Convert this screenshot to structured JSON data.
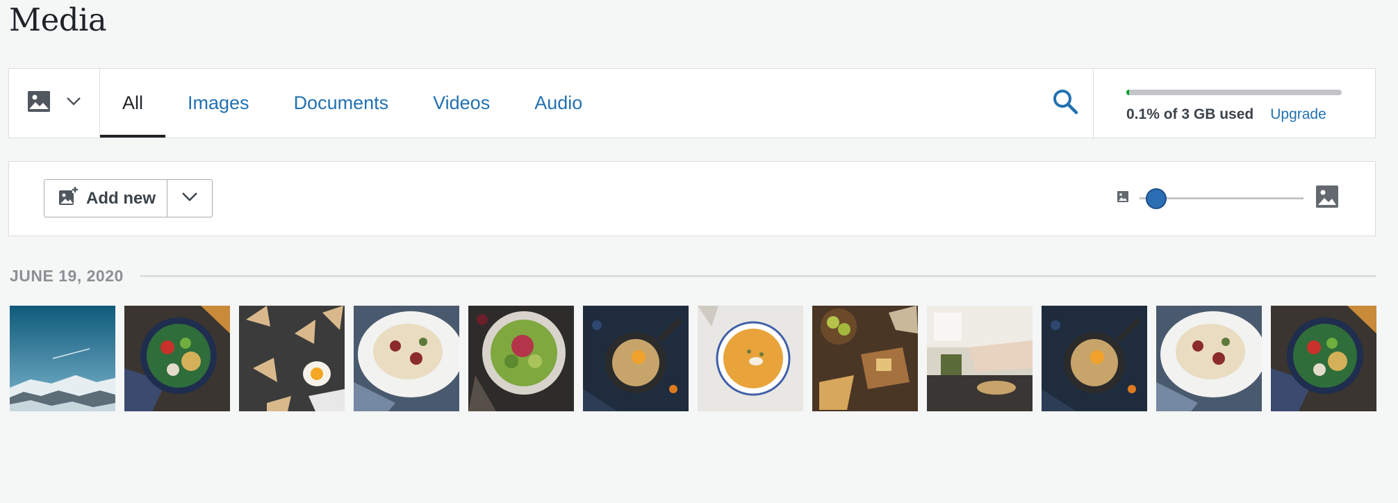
{
  "page": {
    "title": "Media"
  },
  "filter_bar": {
    "type_select_icon": "image-icon",
    "tabs": [
      {
        "label": "All",
        "active": true
      },
      {
        "label": "Images",
        "active": false
      },
      {
        "label": "Documents",
        "active": false
      },
      {
        "label": "Videos",
        "active": false
      },
      {
        "label": "Audio",
        "active": false
      }
    ],
    "search_icon": "search-icon",
    "storage": {
      "used_fraction": 0.001,
      "text": "0.1% of 3 GB used",
      "upgrade_label": "Upgrade"
    }
  },
  "toolbar": {
    "add_new_label": "Add new",
    "zoom_level": 0.1
  },
  "library": {
    "date_label": "JUNE 19, 2020",
    "items": [
      {
        "subject": "snowy mountain landscape"
      },
      {
        "subject": "salad bowl with chickpeas"
      },
      {
        "subject": "toast with fried egg"
      },
      {
        "subject": "pasta plate"
      },
      {
        "subject": "green salad bowl"
      },
      {
        "subject": "skillet dish on dark table"
      },
      {
        "subject": "pumpkin soup bowl"
      },
      {
        "subject": "cheese board with apples"
      },
      {
        "subject": "kitchen cooking scene"
      },
      {
        "subject": "skillet dish on dark table"
      },
      {
        "subject": "pasta plate"
      },
      {
        "subject": "salad bowl with chickpeas"
      }
    ]
  },
  "colors": {
    "accent": "#2271b1",
    "text": "#1d2327",
    "background": "#f5f6f6",
    "slider": "#2c6eb4",
    "storage_fill": "#00a32a"
  }
}
